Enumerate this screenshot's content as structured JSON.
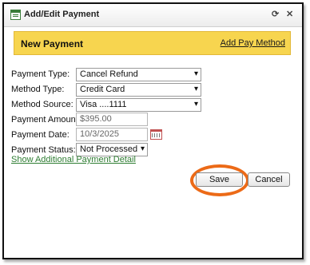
{
  "dialog": {
    "title": "Add/Edit Payment",
    "controls": {
      "refresh_glyph": "⟳",
      "close_glyph": "✕"
    }
  },
  "banner": {
    "title": "New Payment",
    "link": "Add Pay Method",
    "background": "#f7d54f"
  },
  "form": {
    "payment_type": {
      "label": "Payment Type:",
      "value": "Cancel Refund"
    },
    "method_type": {
      "label": "Method Type:",
      "value": "Credit Card"
    },
    "method_source": {
      "label": "Method Source:",
      "value": "Visa ....1111"
    },
    "payment_amount": {
      "label": "Payment Amount:",
      "placeholder": "$395.00"
    },
    "payment_date": {
      "label": "Payment Date:",
      "placeholder": "10/3/2025"
    },
    "payment_status": {
      "label": "Payment Status:",
      "value": "Not Processed"
    },
    "additional_detail_link": "Show Additional Payment Detail"
  },
  "actions": {
    "save_label": "Save",
    "cancel_label": "Cancel",
    "highlight_color": "#ec6a17"
  },
  "icons": {
    "window": "form-window-icon",
    "calendar": "calendar-icon",
    "dropdown": "▾"
  }
}
